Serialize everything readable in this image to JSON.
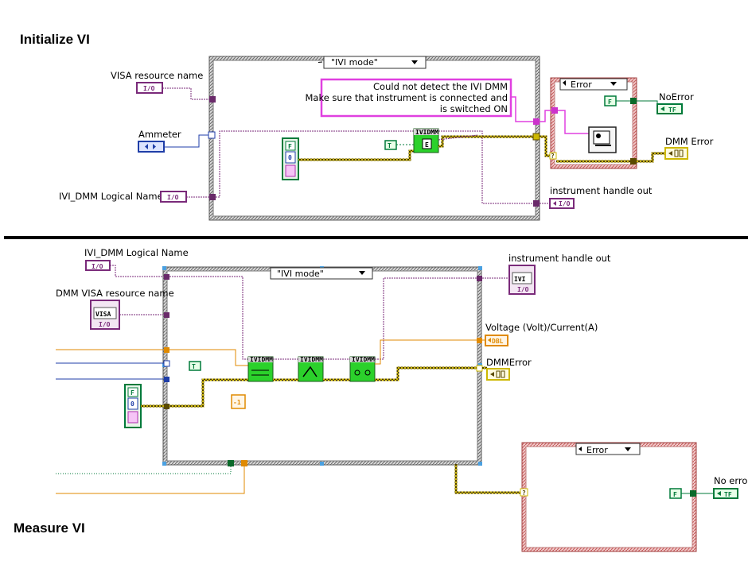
{
  "colors": {
    "error_wire": "#cdb800",
    "refnum_wire": "#7a2a7a",
    "dbl_wire": "#e08a00",
    "bool_wire": "#007a3a",
    "enum_wire": "#1f3ea8",
    "case_border": "#8a8a8a",
    "error_case_border": "#c66a6a",
    "node_green": "#2bd12b",
    "message_border": "#e040e0"
  },
  "top": {
    "heading": "Initialize VI",
    "case_selector": "\"IVI mode\"",
    "visa_label": "VISA resource name",
    "visa_term": "I/O",
    "ammeter_label": "Ammeter",
    "ivi_logical_label": "IVI_DMM Logical Name",
    "ivi_logical_term": "I/O",
    "bool_F": "F",
    "bool_zero": "0",
    "true_const": "T",
    "ivi_node": "IVIDMM",
    "message_lines": [
      "Could not detect the IVI DMM",
      "Make sure that instrument is connected and",
      "is switched ON"
    ],
    "error_selector": "Error",
    "f_const": "F",
    "noerror_label": "NoError",
    "noerror_term": "TF",
    "dmm_error_label": "DMM Error",
    "handle_out_label": "instrument handle out",
    "handle_out_term": "I/O",
    "question": "?"
  },
  "bottom": {
    "heading": "Measure VI",
    "case_selector": "\"IVI mode\"",
    "ivi_logical_label": "IVI_DMM Logical Name",
    "ivi_logical_term": "I/O",
    "visa_label": "DMM VISA resource name",
    "visa_term": "VISA",
    "visa_sub": "I/O",
    "handle_out_label": "instrument handle out",
    "handle_out_term": "IVI",
    "handle_out_sub": "I/O",
    "voltage_label": "Voltage (Volt)/Current(A)",
    "voltage_term": "DBL",
    "dmmerror_label": "DMMError",
    "true_const": "T",
    "neg_one": "-1",
    "bool_F": "F",
    "bool_zero": "0",
    "node1": "IVIDMM",
    "node2": "IVIDMM",
    "node3": "IVIDMM",
    "error_selector": "Error",
    "f_const": "F",
    "noerror_label": "No error",
    "noerror_term": "TF",
    "question": "?"
  }
}
